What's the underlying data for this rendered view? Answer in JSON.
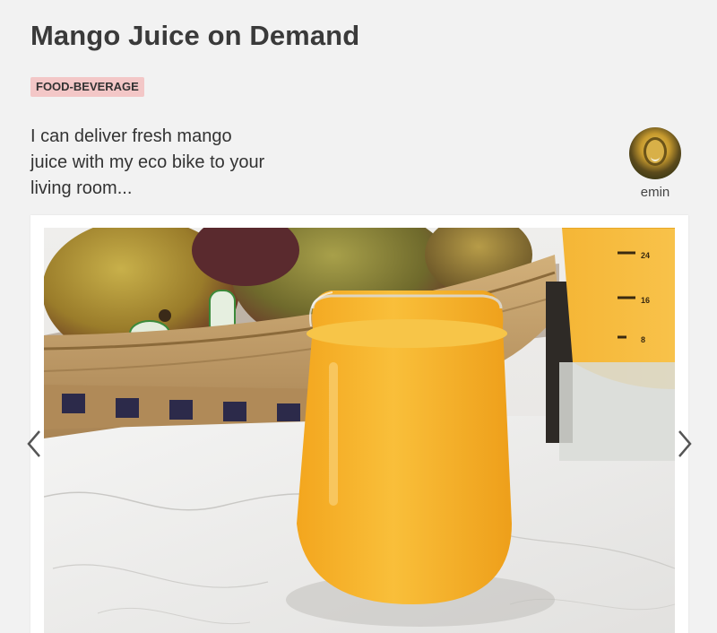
{
  "listing": {
    "title": "Mango Juice on Demand",
    "category": "FOOD-BEVERAGE",
    "description": "I can deliver fresh mango juice with my eco bike to your living room...",
    "author": "emin"
  },
  "carousel": {
    "prev_icon": "chevron-left-icon",
    "next_icon": "chevron-right-icon"
  },
  "pitcher_marks": [
    "24",
    "16",
    "8"
  ],
  "colors": {
    "background": "#f2f2f2",
    "tag_background": "#f3c7c7",
    "juice": "#f7b52a"
  }
}
